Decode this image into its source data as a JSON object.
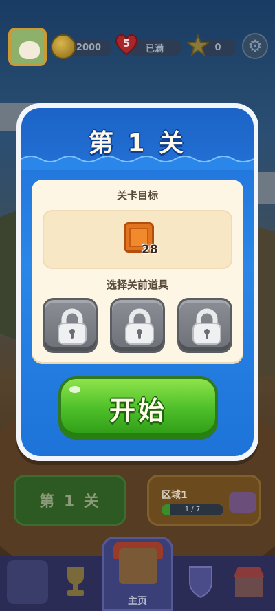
{
  "hud": {
    "coins": "2000",
    "lives_count": "5",
    "lives_status": "已满",
    "stars": "0"
  },
  "dialog": {
    "title": "第 1 关",
    "goal_heading": "关卡目标",
    "goal_item_count": "28",
    "boosters_heading": "选择关前道具",
    "boosters": [
      "locked",
      "locked",
      "locked"
    ],
    "start_label": "开始"
  },
  "bottom": {
    "level_card_label": "第 1 关",
    "area_title": "区域1",
    "area_progress_text": "1 / 7",
    "area_progress_fraction": 0.14
  },
  "nav": {
    "home_label": "主页",
    "items": [
      "flower-icon",
      "trophy-icon",
      "home-icon",
      "shield-icon",
      "shop-icon"
    ]
  },
  "colors": {
    "dialog_blue": "#2a86e8",
    "start_green": "#4fc02a",
    "crate_orange": "#e2731f"
  }
}
